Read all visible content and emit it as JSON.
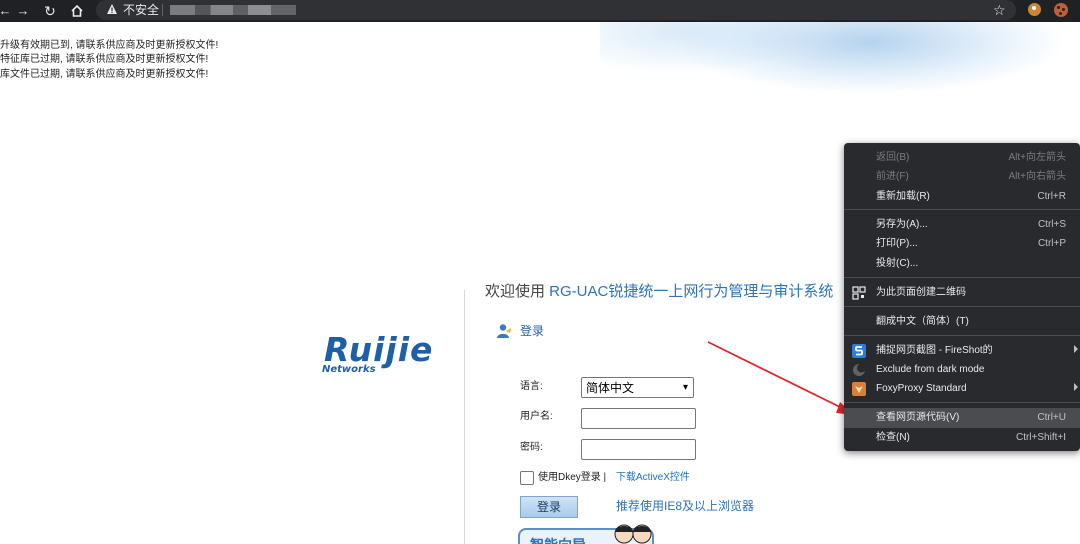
{
  "browser": {
    "security_label": "不安全",
    "icons": [
      "back-icon",
      "forward-icon",
      "reload-icon",
      "home-icon",
      "warning-icon",
      "star-icon",
      "extension-icons"
    ]
  },
  "notices": [
    "升级有效期已到, 请联系供应商及时更新授权文件!",
    "特征库已过期, 请联系供应商及时更新授权文件!",
    "库文件已过期, 请联系供应商及时更新授权文件!"
  ],
  "logo": {
    "name": "Ruijie",
    "sub": "Networks"
  },
  "welcome": {
    "prefix": "欢迎使用 ",
    "product": "RG-UAC锐捷统一上网行为管理与审计系统"
  },
  "login": {
    "title": "登录",
    "language_label": "语言:",
    "language_value": "简体中文",
    "username_label": "用户名:",
    "username_value": "",
    "password_label": "密码:",
    "password_value": "",
    "dkey_label": "使用Dkey登录 |",
    "activex_link": "下载ActiveX控件",
    "submit_label": "登录",
    "browser_tip": "推荐使用IE8及以上浏览器",
    "promo_text": "智能向导"
  },
  "context_menu": {
    "items": [
      {
        "label": "返回(B)",
        "shortcut": "Alt+向左箭头",
        "disabled": true
      },
      {
        "label": "前进(F)",
        "shortcut": "Alt+向右箭头",
        "disabled": true
      },
      {
        "label": "重新加载(R)",
        "shortcut": "Ctrl+R"
      },
      {
        "label": "另存为(A)...",
        "shortcut": "Ctrl+S"
      },
      {
        "label": "打印(P)...",
        "shortcut": "Ctrl+P"
      },
      {
        "label": "投射(C)...",
        "shortcut": ""
      },
      {
        "label": "为此页面创建二维码",
        "shortcut": "",
        "icon": "qr-code-icon"
      },
      {
        "label": "翻成中文（简体）(T)",
        "shortcut": ""
      },
      {
        "label": "捕捉网页截图 - FireShot的",
        "shortcut": "",
        "icon": "fireshot-icon",
        "submenu": true
      },
      {
        "label": "Exclude from dark mode",
        "shortcut": "",
        "icon": "dark-mode-icon"
      },
      {
        "label": "FoxyProxy Standard",
        "shortcut": "",
        "icon": "foxyproxy-icon",
        "submenu": true
      },
      {
        "label": "查看网页源代码(V)",
        "shortcut": "Ctrl+U",
        "highlighted": true
      },
      {
        "label": "检查(N)",
        "shortcut": "Ctrl+Shift+I"
      }
    ]
  },
  "colors": {
    "accent": "#2f72b5",
    "menu_bg": "#292a2d",
    "arrow": "#e0262b"
  }
}
